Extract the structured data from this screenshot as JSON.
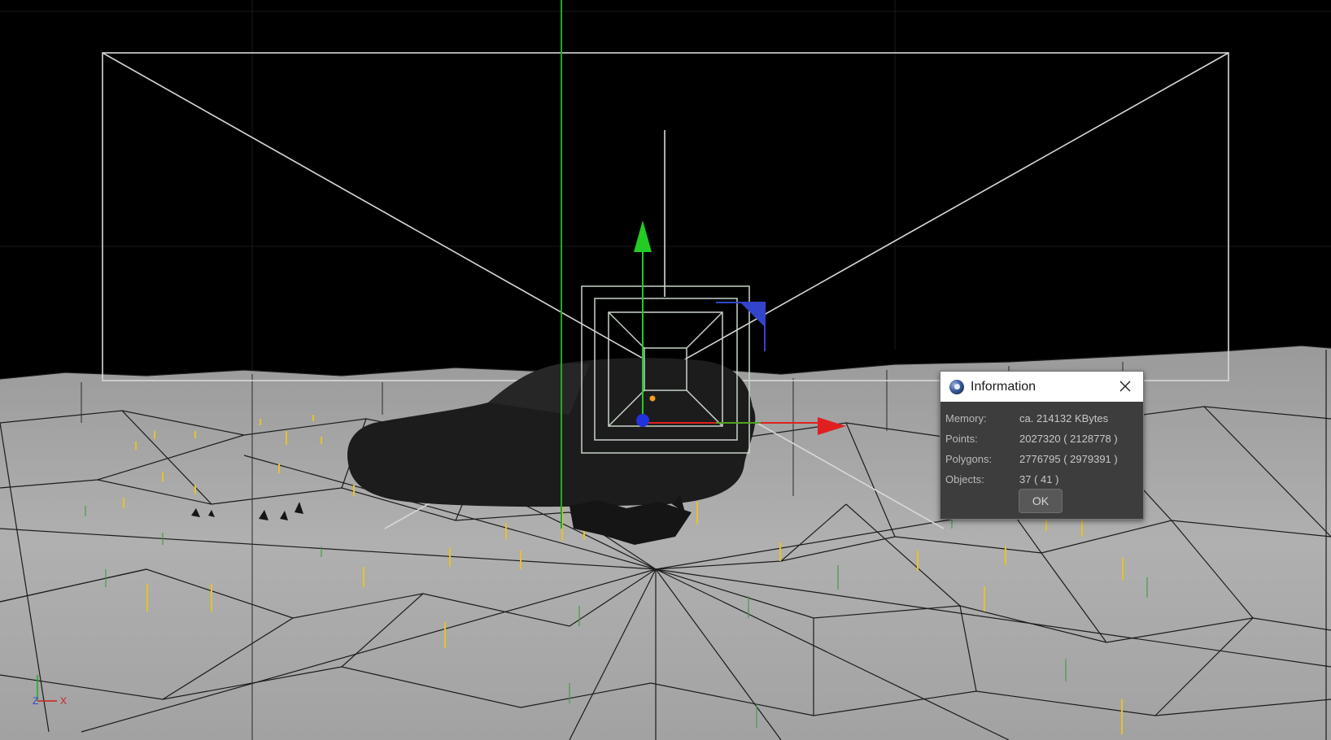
{
  "dialog": {
    "title": "Information",
    "rows": [
      {
        "label": "Memory:",
        "value": "ca. 214132 KBytes"
      },
      {
        "label": "Points:",
        "value": "2027320 ( 2128778 )"
      },
      {
        "label": "Polygons:",
        "value": "2776795 ( 2979391 )"
      },
      {
        "label": "Objects:",
        "value": "37 ( 41 )"
      }
    ],
    "ok_label": "OK"
  },
  "axis_indicator": {
    "z_label": "Z",
    "x_label": "X"
  },
  "colors": {
    "background": "#000000",
    "ground": "#a9a9a9",
    "wire": "#1b1b1b",
    "camera_frame": "#d8d8d8",
    "axis_y": "#22cc22",
    "axis_x": "#e02020",
    "axis_z": "#2030d0",
    "grass_marker": "#e5c22a",
    "dialog_bg": "#3d3d3d"
  }
}
